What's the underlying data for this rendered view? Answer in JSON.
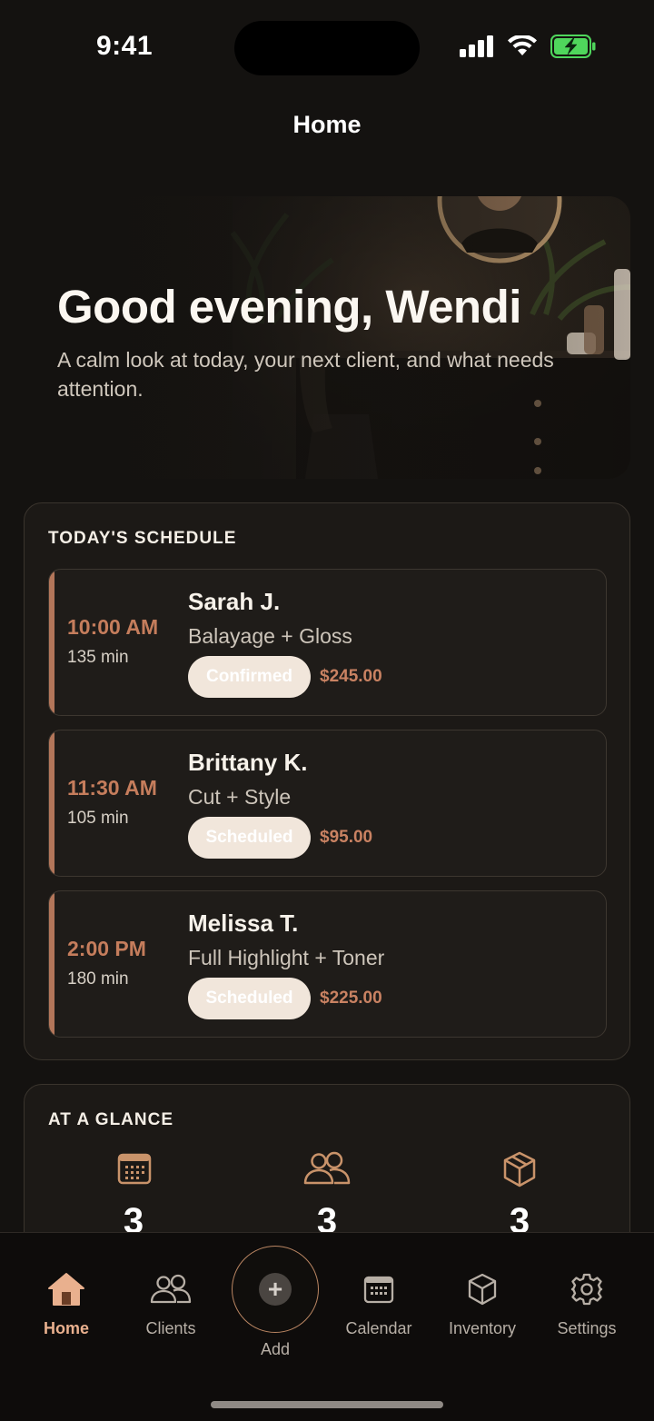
{
  "status_bar": {
    "time": "9:41"
  },
  "nav": {
    "title": "Home"
  },
  "hero": {
    "greeting": "Good evening, Wendi",
    "subtitle": "A calm look at today, your next client, and what needs attention."
  },
  "schedule": {
    "title": "TODAY'S SCHEDULE",
    "appointments": [
      {
        "time": "10:00 AM",
        "duration": "135 min",
        "client": "Sarah J.",
        "service": "Balayage + Gloss",
        "status": "Confirmed",
        "price": "$245.00"
      },
      {
        "time": "11:30 AM",
        "duration": "105 min",
        "client": "Brittany K.",
        "service": "Cut + Style",
        "status": "Scheduled",
        "price": "$95.00"
      },
      {
        "time": "2:00 PM",
        "duration": "180 min",
        "client": "Melissa T.",
        "service": "Full Highlight + Toner",
        "status": "Scheduled",
        "price": "$225.00"
      }
    ]
  },
  "glance": {
    "title": "AT A GLANCE",
    "items": [
      {
        "icon": "calendar-icon",
        "value": "3"
      },
      {
        "icon": "clients-icon",
        "value": "3"
      },
      {
        "icon": "box-icon",
        "value": "3"
      }
    ]
  },
  "tabbar": {
    "home": "Home",
    "clients": "Clients",
    "add": "Add",
    "calendar": "Calendar",
    "inventory": "Inventory",
    "settings": "Settings"
  },
  "colors": {
    "accent": "#c57d5c",
    "active_tab": "#e9b08e",
    "glance_icon": "#c9936a",
    "background": "#141210"
  }
}
